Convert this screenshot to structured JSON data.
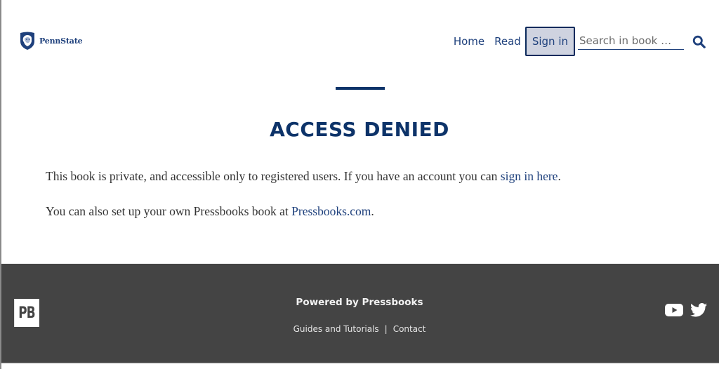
{
  "header": {
    "logo_text": "PennState",
    "nav": {
      "home": "Home",
      "read": "Read",
      "sign_in": "Sign in"
    },
    "search": {
      "placeholder": "Search in book …",
      "value": ""
    },
    "icons": {
      "logo": "penn-state-shield-icon",
      "search": "search-icon"
    }
  },
  "main": {
    "title": "ACCESS DENIED",
    "paragraph1": {
      "text": "This book is private, and accessible only to registered users. If you have an account you can ",
      "link": "sign in here",
      "suffix": "."
    },
    "paragraph2": {
      "text": "You can also set up your own Pressbooks book at ",
      "link": "Pressbooks.com",
      "suffix": "."
    }
  },
  "footer": {
    "logo_text": "PB",
    "powered_by": "Powered by Pressbooks",
    "links": {
      "guides": "Guides and Tutorials",
      "separator": "|",
      "contact": "Contact"
    },
    "social": {
      "youtube": "youtube-icon",
      "twitter": "twitter-icon"
    }
  },
  "colors": {
    "brand": "#1e407c",
    "title": "#0d3369",
    "signin_bg": "#cfd3e0",
    "signin_border": "#0b2a5c",
    "footer_bg": "#444444",
    "body_text": "#333333"
  }
}
